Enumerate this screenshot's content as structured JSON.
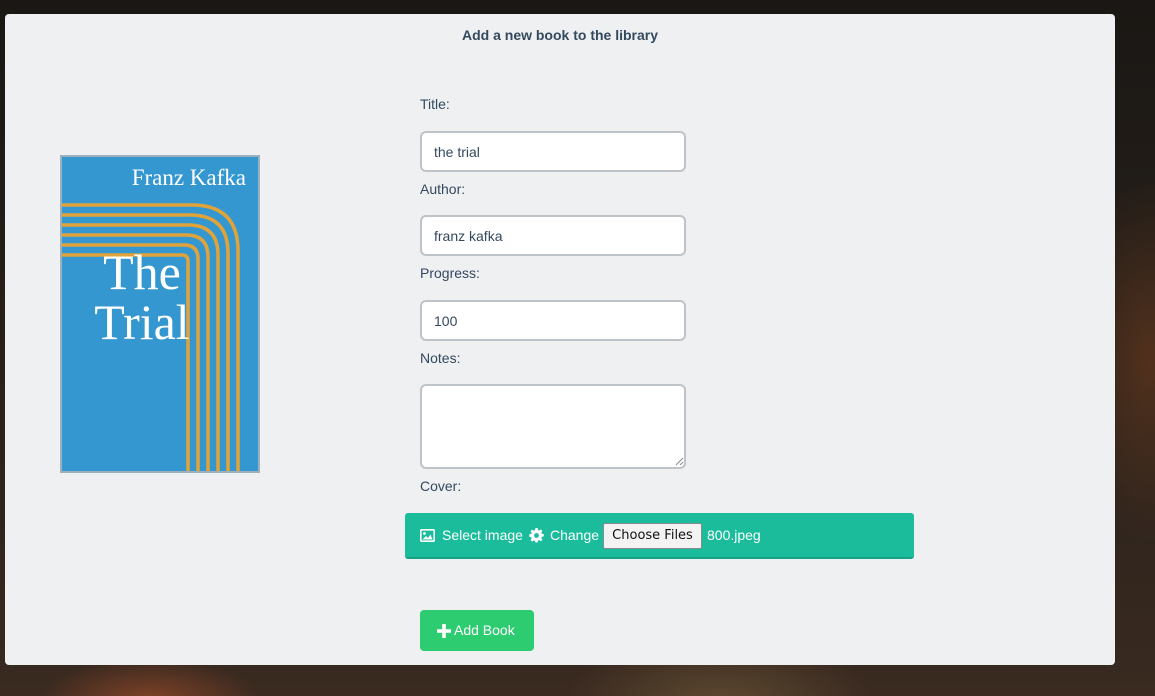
{
  "form": {
    "heading": "Add a new book to the library",
    "title_label": "Title:",
    "title_value": "the trial",
    "author_label": "Author:",
    "author_value": "franz kafka",
    "progress_label": "Progress:",
    "progress_value": "100",
    "notes_label": "Notes:",
    "notes_value": "",
    "cover_label": "Cover:"
  },
  "cover_preview": {
    "author": "Franz Kafka",
    "title": "The Trial",
    "background_color": "#3497d0",
    "line_color": "#e0a33a"
  },
  "cover_upload": {
    "select_icon": "image-icon",
    "select_label": "Select image",
    "change_icon": "gear-icon",
    "change_label": "Change",
    "choose_button": "Choose Files",
    "file_name": "800.jpeg",
    "bar_color": "#1abc9c"
  },
  "submit": {
    "icon": "plus-icon",
    "label": "Add Book",
    "color": "#2ecc71"
  }
}
